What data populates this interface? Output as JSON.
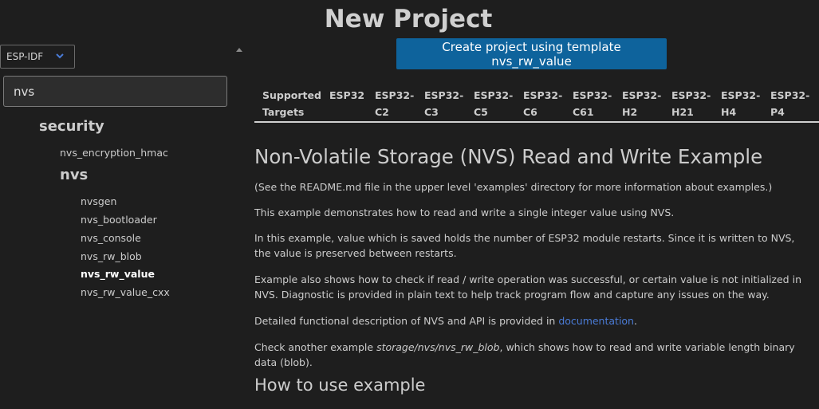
{
  "page_title": "New Project",
  "framework_select": {
    "value": "ESP-IDF",
    "icon": "chevron-down-icon",
    "accent": "#4a7bd6"
  },
  "search": {
    "value": "nvs"
  },
  "tree": {
    "security": "security",
    "nvs_encryption_hmac": "nvs_encryption_hmac",
    "nvs": "nvs",
    "items": [
      "nvsgen",
      "nvs_bootloader",
      "nvs_console",
      "nvs_rw_blob",
      "nvs_rw_value",
      "nvs_rw_value_cxx"
    ],
    "selected": "nvs_rw_value"
  },
  "create_button": {
    "label": "Create project using template nvs_rw_value",
    "color": "#0e639c"
  },
  "targets": {
    "header": [
      "Supported",
      "Targets"
    ],
    "cells": [
      [
        "ESP32",
        ""
      ],
      [
        "ESP32-",
        "C2"
      ],
      [
        "ESP32-",
        "C3"
      ],
      [
        "ESP32-",
        "C5"
      ],
      [
        "ESP32-",
        "C6"
      ],
      [
        "ESP32-",
        "C61"
      ],
      [
        "ESP32-",
        "H2"
      ],
      [
        "ESP32-",
        "H21"
      ],
      [
        "ESP32-",
        "H4"
      ],
      [
        "ESP32-",
        "P4"
      ]
    ]
  },
  "readme": {
    "title": "Non-Volatile Storage (NVS) Read and Write Example",
    "p1": "(See the README.md file in the upper level 'examples' directory for more information about examples.)",
    "p2": "This example demonstrates how to read and write a single integer value using NVS.",
    "p3": "In this example, value which is saved holds the number of ESP32 module restarts. Since it is written to NVS, the value is preserved between restarts.",
    "p4": "Example also shows how to check if read / write operation was successful, or certain value is not initialized in NVS. Diagnostic is provided in plain text to help track program flow and capture any issues on the way.",
    "p5_before": "Detailed functional description of NVS and API is provided in ",
    "p5_link": "documentation",
    "p5_after": ".",
    "p6_before": "Check another example ",
    "p6_em": "storage/nvs/nvs_rw_blob",
    "p6_after": ", which shows how to read and write variable length binary data (blob).",
    "h2": "How to use example"
  }
}
